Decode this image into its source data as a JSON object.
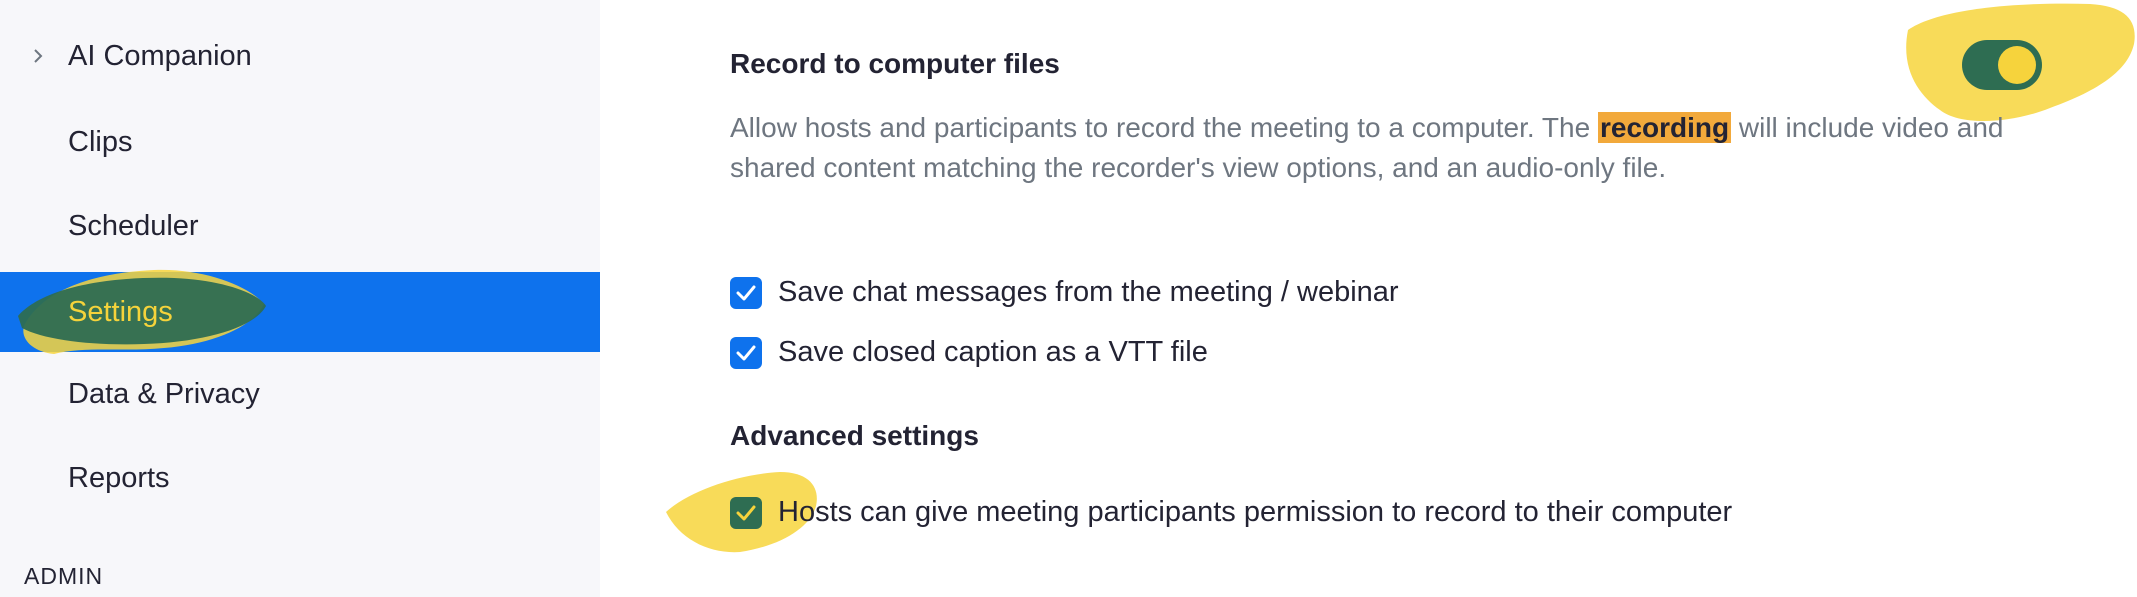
{
  "sidebar": {
    "items": [
      {
        "label": "AI Companion",
        "has_chevron": true
      },
      {
        "label": "Clips"
      },
      {
        "label": "Scheduler"
      },
      {
        "label": "Settings",
        "active": true
      },
      {
        "label": "Data & Privacy"
      },
      {
        "label": "Reports"
      }
    ],
    "section_label": "ADMIN"
  },
  "main": {
    "setting": {
      "title": "Record to computer files",
      "desc_before": "Allow hosts and participants to record the meeting to a computer. The ",
      "desc_highlight": "recording",
      "desc_after": " will include video and shared content matching the recorder's view options, and an audio-only file.",
      "toggle_on": true
    },
    "options": [
      {
        "label": "Save chat messages from the meeting / webinar",
        "checked": true
      },
      {
        "label": "Save closed caption as a VTT file",
        "checked": true
      }
    ],
    "advanced": {
      "title": "Advanced settings",
      "options": [
        {
          "label": "Hosts can give meeting participants permission to record to their computer",
          "checked": true
        }
      ]
    }
  },
  "colors": {
    "accent": "#0e72ed",
    "active_text": "#f5d33b",
    "toggle_track": "#2e6d52",
    "toggle_knob": "#f6d33c",
    "highlight": "#f2a93b",
    "marker_yellow": "#f7d53c",
    "marker_green": "#2e6d52"
  },
  "icons": {
    "chevron": "chevron-right-icon",
    "check": "check-icon"
  }
}
